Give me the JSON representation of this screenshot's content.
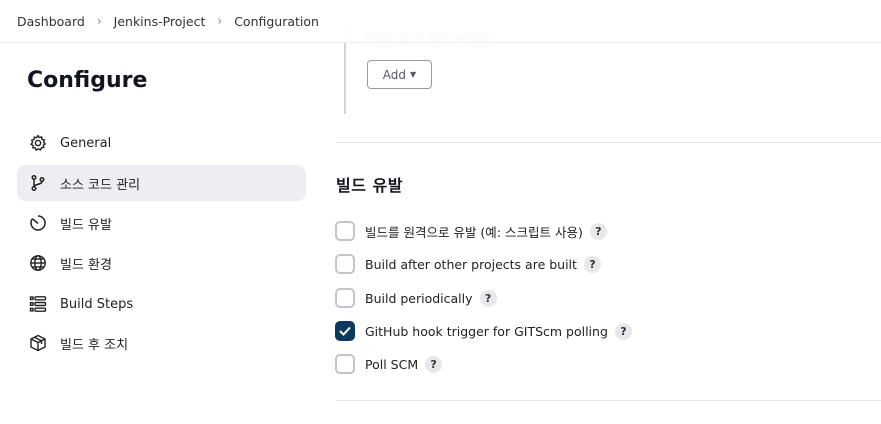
{
  "breadcrumb": [
    "Dashboard",
    "Jenkins-Project",
    "Configuration"
  ],
  "sidebar": {
    "title": "Configure",
    "items": [
      {
        "label": "General",
        "icon": "gear-icon",
        "active": false
      },
      {
        "label": "소스 코드 관리",
        "icon": "branch-icon",
        "active": true
      },
      {
        "label": "빌드 유발",
        "icon": "timer-icon",
        "active": false
      },
      {
        "label": "빌드 환경",
        "icon": "globe-icon",
        "active": false
      },
      {
        "label": "Build Steps",
        "icon": "list-icon",
        "active": false
      },
      {
        "label": "빌드 후 조치",
        "icon": "package-icon",
        "active": false
      }
    ]
  },
  "main": {
    "additional_label": "Additional Behaviours",
    "add_button": "Add",
    "triggers_title": "빌드 유발",
    "triggers": [
      {
        "label": "빌드를 원격으로 유발 (예: 스크립트 사용)",
        "checked": false
      },
      {
        "label": "Build after other projects are built",
        "checked": false
      },
      {
        "label": "Build periodically",
        "checked": false
      },
      {
        "label": "GitHub hook trigger for GITScm polling",
        "checked": true
      },
      {
        "label": "Poll SCM",
        "checked": false
      }
    ],
    "help_glyph": "?"
  },
  "colors": {
    "checkbox_checked": "#0b3a5e",
    "nav_active": "#eeeef2"
  }
}
